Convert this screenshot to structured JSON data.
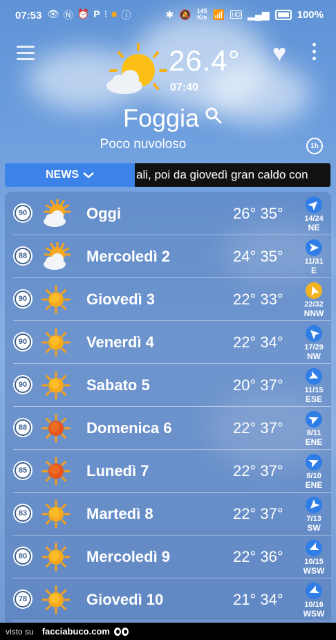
{
  "status_bar": {
    "time": "07:53",
    "net_speed_value": "145",
    "net_speed_unit": "K/s",
    "hd_badge": "HD",
    "battery_percent": "100%"
  },
  "header": {
    "temperature": "26.4°",
    "observation_time": "07:40",
    "city": "Foggia",
    "condition": "Poco nuvoloso",
    "history_badge": "1h"
  },
  "news": {
    "label": "NEWS",
    "ticker": "ali, poi da giovedì gran caldo con"
  },
  "forecast": [
    {
      "aqi": "90",
      "icon": "partly-cloudy-icon",
      "day": "Oggi",
      "temps": "26° 35°",
      "wind_speed": "14/24",
      "wind_dir": "NE",
      "arrow": "northeast-arrow-icon",
      "arrow_color": "#2f7de6"
    },
    {
      "aqi": "88",
      "icon": "partly-cloudy-icon",
      "day": "Mercoledì 2",
      "temps": "24° 35°",
      "wind_speed": "11/31",
      "wind_dir": "E",
      "arrow": "east-arrow-icon",
      "arrow_color": "#2f7de6"
    },
    {
      "aqi": "90",
      "icon": "sun-icon",
      "day": "Giovedì 3",
      "temps": "22° 33°",
      "wind_speed": "22/32",
      "wind_dir": "NNW",
      "arrow": "north-northwest-arrow-icon",
      "arrow_color": "#f2b320"
    },
    {
      "aqi": "90",
      "icon": "sun-icon",
      "day": "Venerdì 4",
      "temps": "22° 34°",
      "wind_speed": "17/29",
      "wind_dir": "NW",
      "arrow": "northwest-arrow-icon",
      "arrow_color": "#2f7de6"
    },
    {
      "aqi": "90",
      "icon": "sun-icon",
      "day": "Sabato 5",
      "temps": "20° 37°",
      "wind_speed": "11/15",
      "wind_dir": "ESE",
      "arrow": "east-southeast-arrow-icon",
      "arrow_color": "#2f7de6"
    },
    {
      "aqi": "88",
      "icon": "hot-sun-icon",
      "day": "Domenica 6",
      "temps": "22° 37°",
      "wind_speed": "8/11",
      "wind_dir": "ENE",
      "arrow": "east-northeast-arrow-icon",
      "arrow_color": "#2f7de6"
    },
    {
      "aqi": "85",
      "icon": "hot-sun-icon",
      "day": "Lunedì 7",
      "temps": "22° 37°",
      "wind_speed": "8/10",
      "wind_dir": "ENE",
      "arrow": "east-northeast-arrow-icon",
      "arrow_color": "#2f7de6"
    },
    {
      "aqi": "83",
      "icon": "sun-icon",
      "day": "Martedì 8",
      "temps": "22° 37°",
      "wind_speed": "7/13",
      "wind_dir": "SW",
      "arrow": "southwest-arrow-icon",
      "arrow_color": "#2f7de6"
    },
    {
      "aqi": "80",
      "icon": "sun-icon",
      "day": "Mercoledì 9",
      "temps": "22° 36°",
      "wind_speed": "10/15",
      "wind_dir": "WSW",
      "arrow": "west-southwest-arrow-icon",
      "arrow_color": "#2f7de6"
    },
    {
      "aqi": "78",
      "icon": "sun-icon",
      "day": "Giovedì 10",
      "temps": "21° 34°",
      "wind_speed": "10/16",
      "wind_dir": "WSW",
      "arrow": "west-southwest-arrow-icon",
      "arrow_color": "#2f7de6"
    }
  ],
  "footer": {
    "visto": "visto su",
    "brand": "facciabuco.com"
  }
}
